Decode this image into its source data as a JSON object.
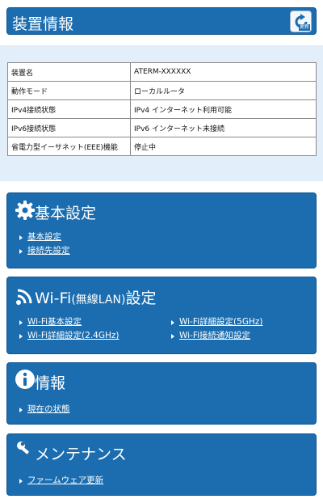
{
  "header": {
    "title": "装置情報",
    "refresh_label": "更新"
  },
  "device_info": {
    "rows": [
      {
        "label": "装置名",
        "value": "ATERM-XXXXXX"
      },
      {
        "label": "動作モード",
        "value": "ローカルルータ"
      },
      {
        "label": "IPv4接続状態",
        "value": "IPv4 インターネット利用可能"
      },
      {
        "label": "IPv6接続状態",
        "value": "IPv6 インターネット未接続"
      },
      {
        "label": "省電力型イーサネット(EEE)機能",
        "value": "停止中"
      }
    ]
  },
  "sections": {
    "basic": {
      "title": "基本設定",
      "links": [
        "基本設定",
        "接続先設定"
      ]
    },
    "wifi": {
      "title_main": "Wi-Fi",
      "title_paren": "(無線LAN)",
      "title_tail": "設定",
      "links": [
        "Wi-Fi基本設定",
        "Wi-Fi詳細設定(2.4GHz)",
        "Wi-Fi詳細設定(5GHz)",
        "Wi-Fi接続通知設定"
      ]
    },
    "info": {
      "title": "情報",
      "links": [
        "現在の状態"
      ]
    },
    "maintenance": {
      "title": "メンテナンス",
      "links": [
        "ファームウェア更新"
      ]
    }
  },
  "icons": {
    "refresh": "refresh-icon",
    "basic": "gear-icon",
    "wifi": "wifi-icon",
    "info": "info-icon",
    "maintenance": "wrench-icon"
  },
  "colors": {
    "panel": "#1b6db0",
    "band": "#e2eefa"
  }
}
